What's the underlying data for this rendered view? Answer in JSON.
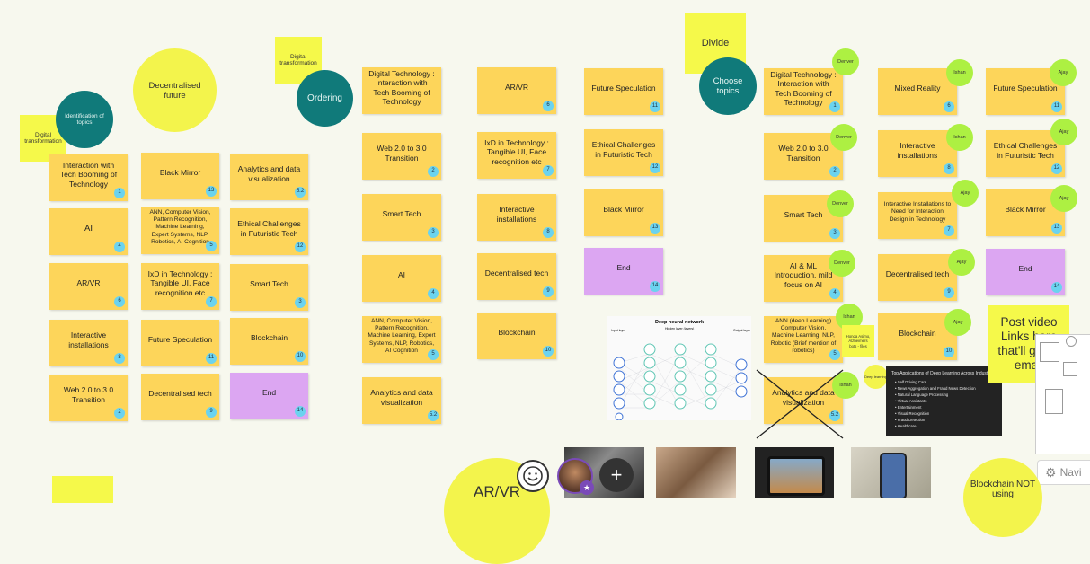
{
  "circles": {
    "identification": "Identification of topics",
    "decentralised_future": "Decentralised future",
    "ordering": "Ordering",
    "choose_topics": "Choose topics",
    "ar_vr_bottom": "AR/VR",
    "blockchain_bottom": "Blockchain NOT using"
  },
  "stickies": {
    "digital_transformation_1": "Digital transformation",
    "digital_transformation_2": "Digital transformation",
    "divide": "Divide",
    "honda_asimo": "Honda Asimo, Alzheimers bots - files",
    "deep_learning": "Deep learning",
    "post_video": "Post video Links here that'll go for email"
  },
  "col1": [
    {
      "text": "Interaction with Tech Booming of Technology",
      "num": "1"
    },
    {
      "text": "AI",
      "num": "4"
    },
    {
      "text": "AR/VR",
      "num": "6"
    },
    {
      "text": "Interactive installations",
      "num": "8"
    },
    {
      "text": "Web 2.0 to 3.0 Transition",
      "num": "2"
    }
  ],
  "col2": [
    {
      "text": "Black Mirror",
      "num": "13"
    },
    {
      "text": "ANN, Computer Vision, Pattern Recognition, Machine Learning, Expert Systems, NLP, Robotics, AI Cognition",
      "num": "5"
    },
    {
      "text": "IxD in Technology : Tangible UI, Face recognition etc",
      "num": "7"
    },
    {
      "text": "Future Speculation",
      "num": "11"
    },
    {
      "text": "Decentralised tech",
      "num": "9"
    }
  ],
  "col3": [
    {
      "text": "Analytics and data visualization",
      "num": "5.2"
    },
    {
      "text": "Ethical Challenges in Futuristic Tech",
      "num": "12"
    },
    {
      "text": "Smart Tech",
      "num": "3"
    },
    {
      "text": "Blockchain",
      "num": "10"
    },
    {
      "text": "End",
      "num": "14"
    }
  ],
  "col4": [
    {
      "text": "Digital Technology : Interaction with Tech Booming of Technology",
      "num": "1"
    },
    {
      "text": "Web 2.0 to 3.0 Transition",
      "num": "2"
    },
    {
      "text": "Smart Tech",
      "num": "3"
    },
    {
      "text": "AI",
      "num": "4"
    },
    {
      "text": "ANN, Computer Vision, Pattern Recognition, Machine Learning, Expert Systems, NLP, Robotics, AI Cognition",
      "num": "5"
    },
    {
      "text": "Analytics and data visualization",
      "num": "5.2"
    }
  ],
  "col5": [
    {
      "text": "AR/VR",
      "num": "6"
    },
    {
      "text": "IxD in Technology : Tangible UI, Face recognition etc",
      "num": "7"
    },
    {
      "text": "Interactive installations",
      "num": "8"
    },
    {
      "text": "Decentralised tech",
      "num": "9"
    },
    {
      "text": "Blockchain",
      "num": "10"
    }
  ],
  "col6": [
    {
      "text": "Future Speculation",
      "num": "11"
    },
    {
      "text": "Ethical Challenges in Futuristic Tech",
      "num": "12"
    },
    {
      "text": "Black Mirror",
      "num": "13"
    },
    {
      "text": "End",
      "num": "14"
    }
  ],
  "col7": [
    {
      "text": "Digital Technology : Interaction with Tech Booming of Technology",
      "num": "1",
      "who": "Denver"
    },
    {
      "text": "Web 2.0 to 3.0 Transition",
      "num": "2",
      "who": "Denver"
    },
    {
      "text": "Smart Tech",
      "num": "3",
      "who": "Denver"
    },
    {
      "text": "AI & ML Introduction, mild focus on AI",
      "num": "4",
      "who": "Denver"
    },
    {
      "text": "ANN (deep Learning) Computer Vision, Machine Learning, NLP, Robotic (Brief mention of robotics)",
      "num": "5",
      "who": "Ishan"
    },
    {
      "text": "Analytics and data visualization",
      "num": "5.2",
      "who": "Ishan"
    }
  ],
  "col8": [
    {
      "text": "Mixed Reality",
      "num": "6",
      "who": "Ishan"
    },
    {
      "text": "Interactive installations",
      "num": "8",
      "who": "Ishan"
    },
    {
      "text": "Interactive Installations to Need for Interaction Design in Technology",
      "num": "7",
      "who": "Ajay"
    },
    {
      "text": "Decentralised tech",
      "num": "9",
      "who": "Ajay"
    },
    {
      "text": "Blockchain",
      "num": "10",
      "who": "Ajay"
    }
  ],
  "col9": [
    {
      "text": "Future Speculation",
      "num": "11",
      "who": "Ajay"
    },
    {
      "text": "Ethical Challenges in Futuristic Tech",
      "num": "12",
      "who": "Ajay"
    },
    {
      "text": "Black Mirror",
      "num": "13",
      "who": "Ajay"
    },
    {
      "text": "End",
      "num": "14"
    }
  ],
  "neural": {
    "title": "Deep neural network",
    "input_label": "Input layer",
    "hidden_label": "Hidden layer (layers)",
    "output_label": "Output layer"
  },
  "dark_card": {
    "title": "Top Applications of Deep Learning Across Industries",
    "items": [
      "Self Driving Cars",
      "News Aggregation and Fraud News Detection",
      "Natural Language Processing",
      "Virtual Assistants",
      "Entertainment",
      "Visual Recognition",
      "Fraud Detection",
      "Healthcare"
    ]
  },
  "toolbar": {
    "add": "+",
    "navigate": "Navi"
  }
}
